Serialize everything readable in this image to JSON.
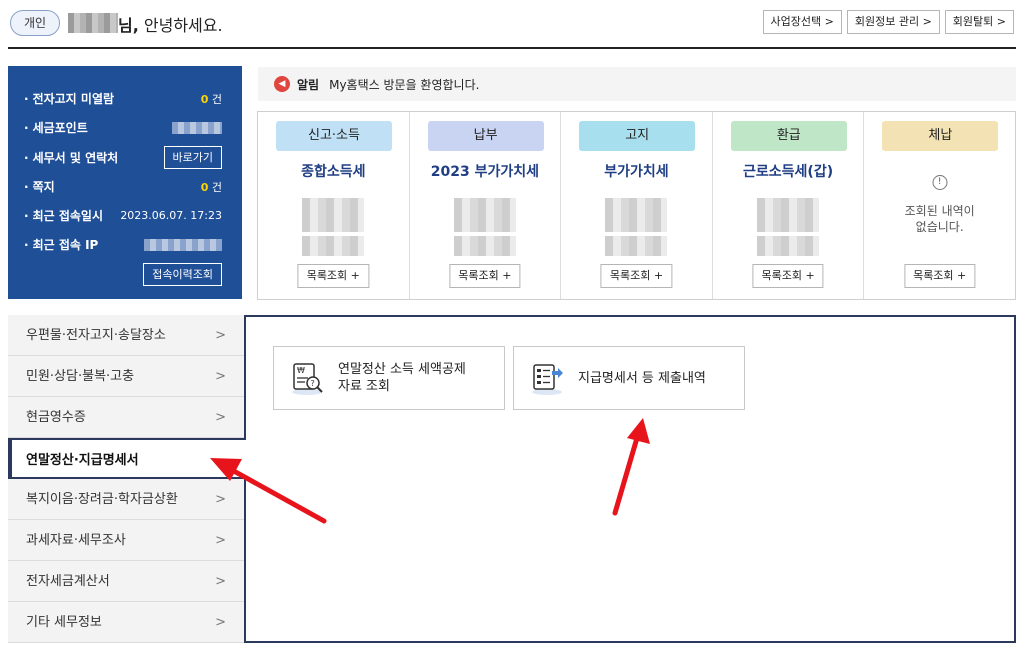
{
  "header": {
    "badge": "개인",
    "greeting_nim": "님,",
    "greeting_rest": " 안녕하세요.",
    "links": [
      "사업장선택 >",
      "회원정보 관리 >",
      "회원탈퇴 >"
    ]
  },
  "info_box": {
    "rows": [
      {
        "label": "전자고지 미열람",
        "count": "0",
        "unit": "건"
      },
      {
        "label": "세금포인트"
      },
      {
        "label": "세무서 및 연락처",
        "button": "바로가기"
      },
      {
        "label": "쪽지",
        "count": "0",
        "unit": "건"
      },
      {
        "label": "최근 접속일시",
        "value": "2023.06.07.  17:23"
      },
      {
        "label": "최근 접속 IP"
      }
    ],
    "history_button": "접속이력조회"
  },
  "notice": {
    "label": "알림",
    "text": "My홈택스 방문을 환영합니다."
  },
  "categories": [
    {
      "head": "신고·소득",
      "sub": "종합소득세",
      "button": "목록조회 +",
      "color": "#bfe0f5"
    },
    {
      "head": "납부",
      "sub": "2023 부가가치세",
      "button": "목록조회 +",
      "color": "#c9d3f2"
    },
    {
      "head": "고지",
      "sub": "부가가치세",
      "button": "목록조회 +",
      "color": "#a7dfee"
    },
    {
      "head": "환급",
      "sub": "근로소득세(갑)",
      "button": "목록조회 +",
      "color": "#bfe6c6"
    },
    {
      "head": "체납",
      "empty_icon": "!",
      "empty_line1": "조회된 내역이",
      "empty_line2": "없습니다.",
      "button": "목록조회 +",
      "color": "#f3e2b3"
    }
  ],
  "menu": {
    "items": [
      "우편물·전자고지·송달장소",
      "민원·상담·불복·고충",
      "현금영수증",
      "연말정산·지급명세서",
      "복지이음·장려금·학자금상환",
      "과세자료·세무조사",
      "전자세금계산서",
      "기타 세무정보"
    ],
    "chevron": ">"
  },
  "content": {
    "tile1_line1": "연말정산 소득 세액공제",
    "tile1_line2": "자료 조회",
    "tile2_label": "지급명세서 등 제출내역"
  }
}
